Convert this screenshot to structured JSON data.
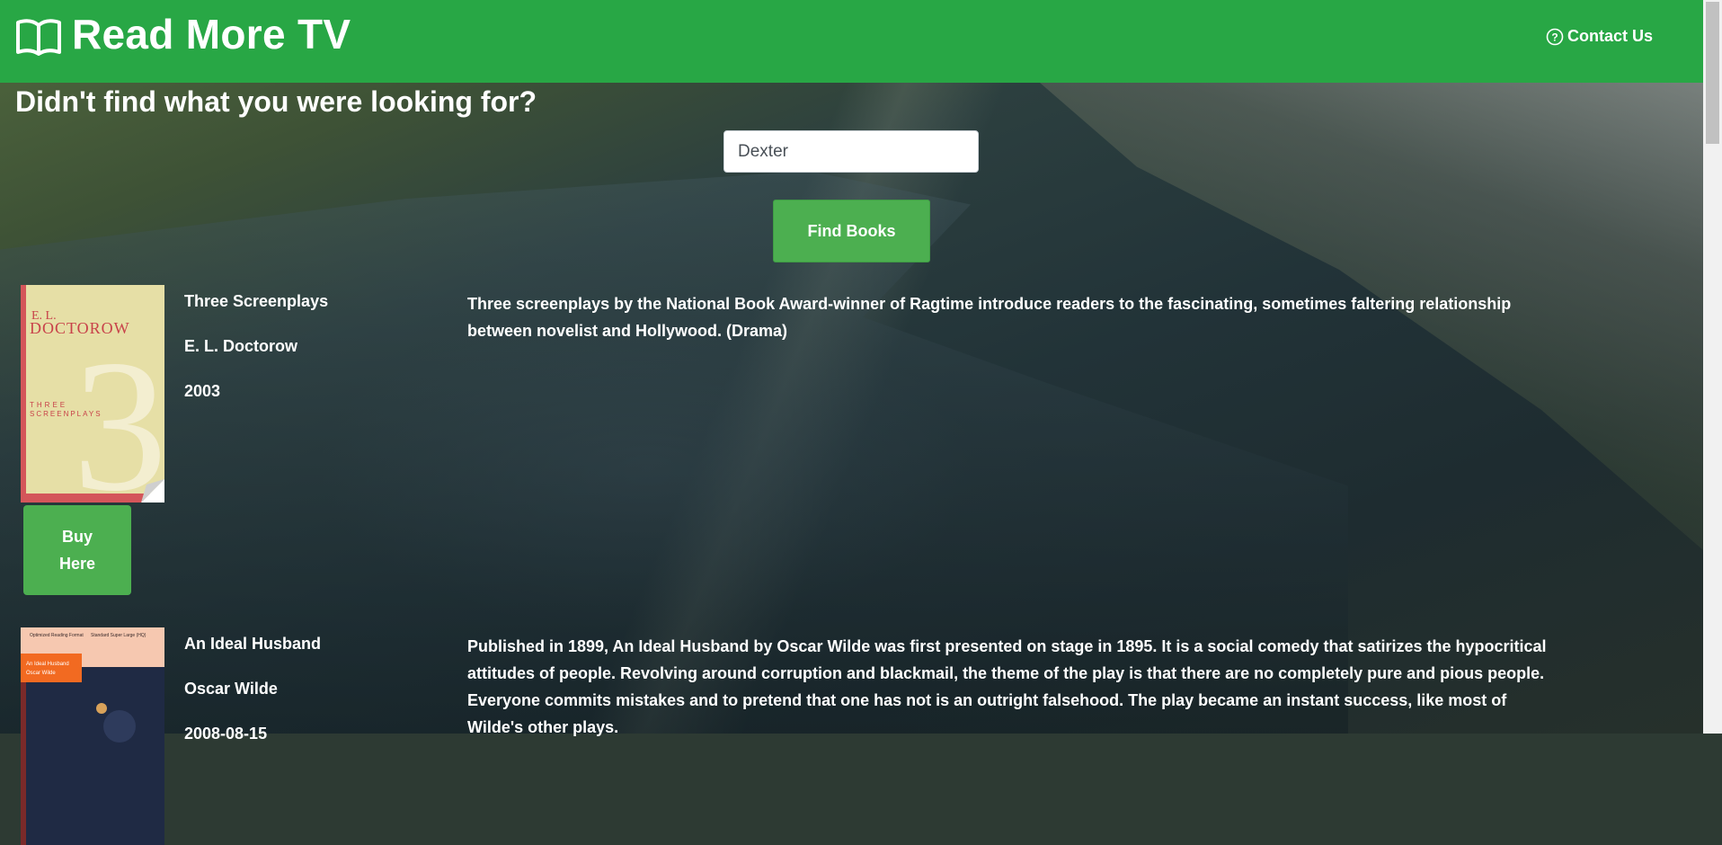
{
  "header": {
    "brand": "Read More TV",
    "contact_label": "Contact Us"
  },
  "search": {
    "headline": "Didn't find what you were looking for?",
    "query": "Dexter",
    "button_label": "Find Books"
  },
  "books": [
    {
      "title": "Three Screenplays",
      "author": "E. L. Doctorow",
      "date": "2003",
      "description": "Three screenplays by the National Book Award-winner of Ragtime introduce readers to the fascinating, sometimes faltering relationship between novelist and Hollywood. (Drama)",
      "buy_label": "Buy Here",
      "cover": {
        "line1": "E. L.",
        "line2": "DOCTOROW",
        "numeral": "3",
        "line3": "THREE",
        "line4": "SCREENPLAYS"
      }
    },
    {
      "title": "An Ideal Husband",
      "author": "Oscar Wilde",
      "date": "2008-08-15",
      "description": "Published in 1899, An Ideal Husband by Oscar Wilde was first presented on stage in 1895. It is a social comedy that satirizes the hypocritical attitudes of people. Revolving around corruption and blackmail, the theme of the play is that there are no completely pure and pious people. Everyone commits mistakes and to pretend that one has not is an outright falsehood. The play became an instant success, like most of Wilde's other plays.",
      "cover": {
        "tag1": "Optimized Reading Format",
        "tag2": "Standard Super Large (HQ)",
        "line1": "An Ideal Husband",
        "line2": "Oscar Wilde"
      }
    }
  ],
  "colors": {
    "header_green": "#28a745",
    "button_green": "#4caf50"
  }
}
